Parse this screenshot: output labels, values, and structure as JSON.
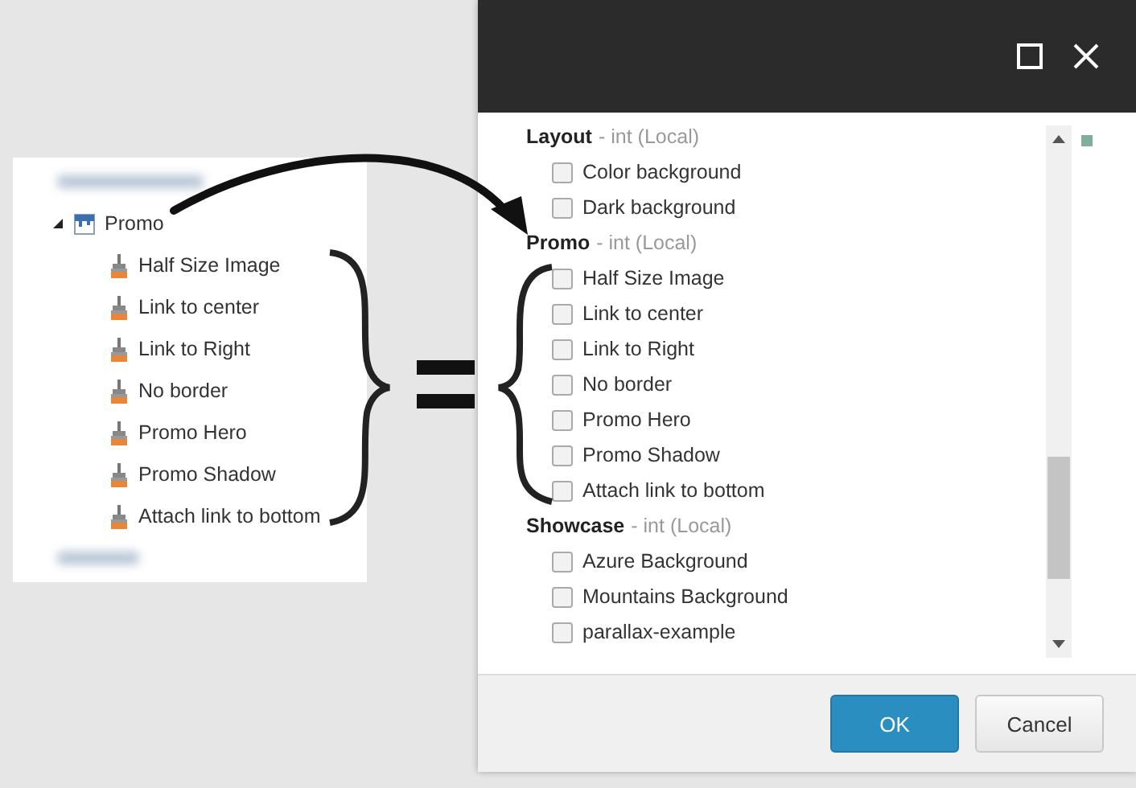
{
  "tree": {
    "items": [
      {
        "label": "Promo",
        "expanded": true,
        "children": [
          {
            "label": "Half Size Image"
          },
          {
            "label": "Link to center"
          },
          {
            "label": "Link to Right"
          },
          {
            "label": "No border"
          },
          {
            "label": "Promo Hero"
          },
          {
            "label": "Promo Shadow"
          },
          {
            "label": "Attach link to bottom"
          }
        ]
      }
    ]
  },
  "dialog": {
    "groups": [
      {
        "name": "Layout",
        "type": "- int (Local)",
        "options": [
          {
            "label": "Color background",
            "checked": false
          },
          {
            "label": "Dark background",
            "checked": false
          }
        ]
      },
      {
        "name": "Promo",
        "type": "- int (Local)",
        "options": [
          {
            "label": "Half Size Image",
            "checked": false
          },
          {
            "label": "Link to center",
            "checked": false
          },
          {
            "label": "Link to Right",
            "checked": false
          },
          {
            "label": "No border",
            "checked": false
          },
          {
            "label": "Promo Hero",
            "checked": false
          },
          {
            "label": "Promo Shadow",
            "checked": false
          },
          {
            "label": "Attach link to bottom",
            "checked": false
          }
        ]
      },
      {
        "name": "Showcase",
        "type": "- int (Local)",
        "options": [
          {
            "label": "Azure Background",
            "checked": false
          },
          {
            "label": "Mountains Background",
            "checked": false
          },
          {
            "label": "parallax-example",
            "checked": false
          }
        ]
      }
    ],
    "buttons": [
      {
        "label": "OK",
        "kind": "primary"
      },
      {
        "label": "Cancel",
        "kind": "secondary"
      }
    ]
  }
}
